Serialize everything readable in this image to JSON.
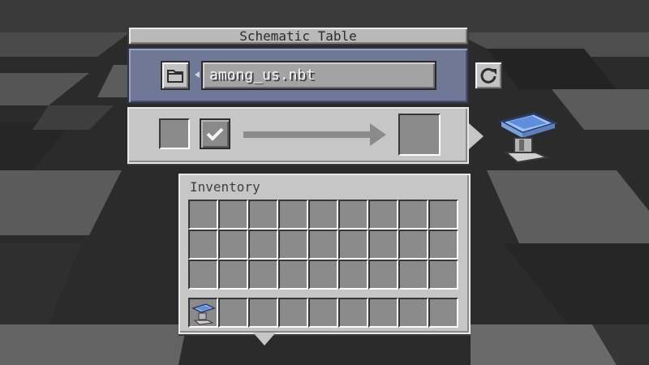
{
  "window": {
    "title": "Schematic Table"
  },
  "file_selector": {
    "filename": "among_us.nbt",
    "folder_icon": "folder-icon",
    "refresh_icon": "refresh-icon"
  },
  "crafting": {
    "input_slot": "empty",
    "confirm_icon": "checkmark-icon",
    "output_slot": "empty"
  },
  "inventory": {
    "label": "Inventory",
    "rows": 3,
    "columns": 9,
    "hotbar": [
      {
        "slot": 1,
        "item_icon": "schematic-table-icon"
      }
    ]
  },
  "colors": {
    "panel_gray": "#c6c6c6",
    "file_panel_blue": "#6f7896",
    "slot_gray": "#8b8b8b"
  }
}
